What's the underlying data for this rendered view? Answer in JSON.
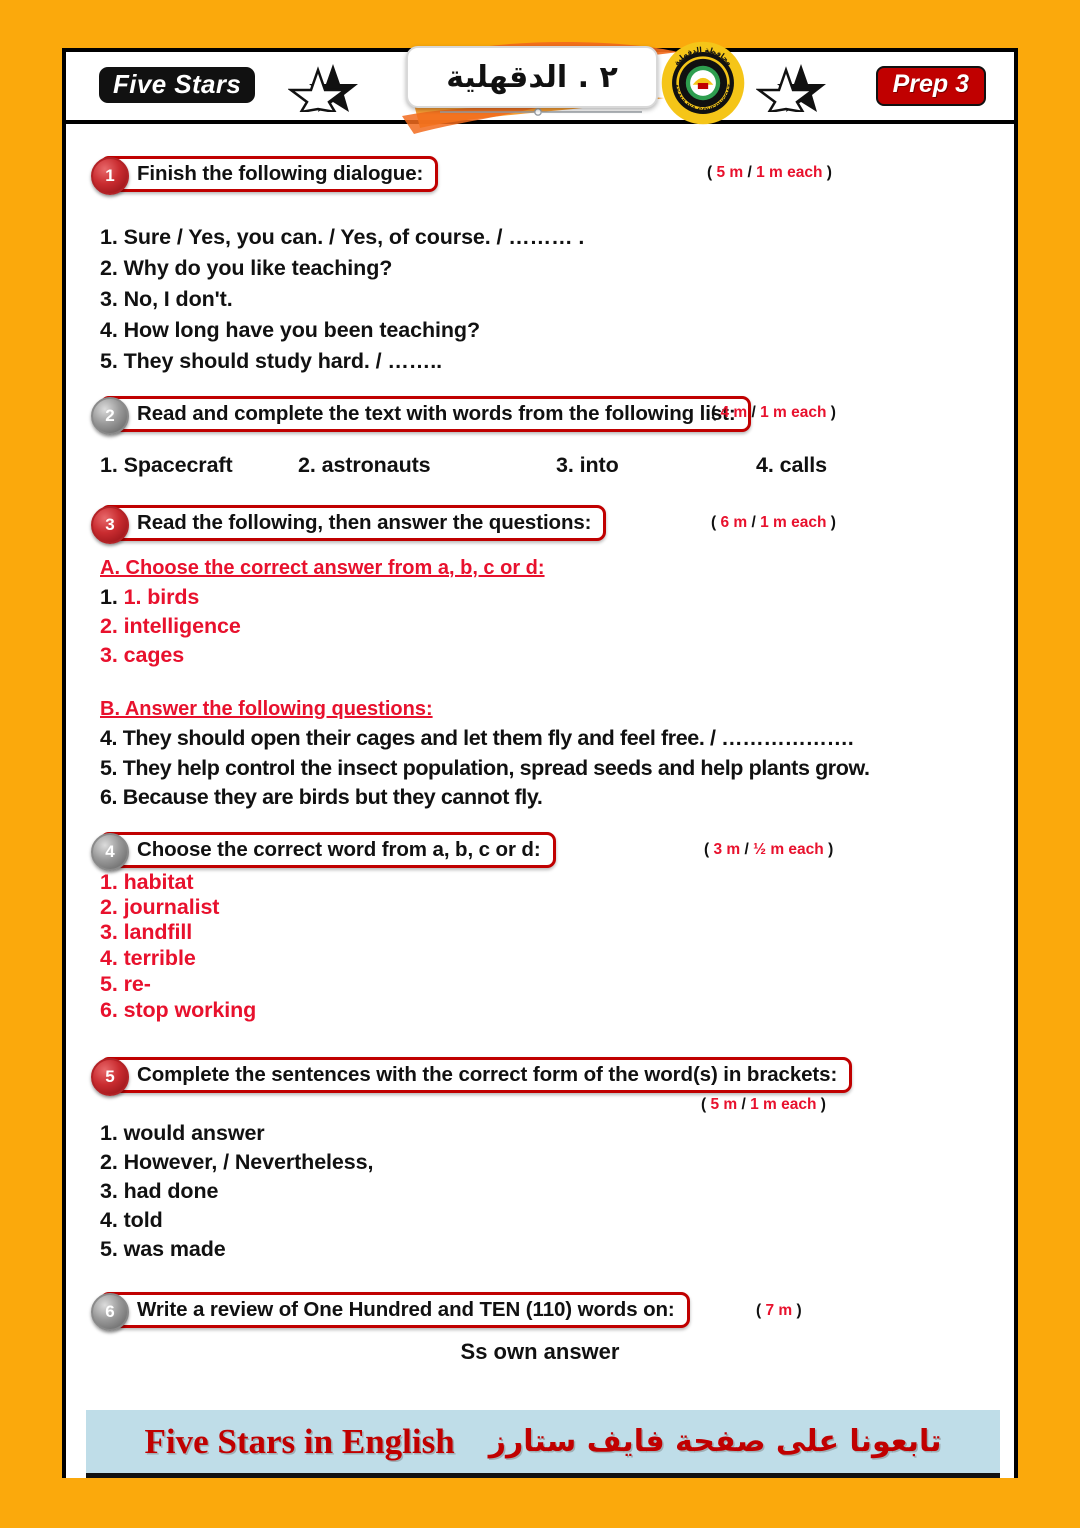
{
  "header": {
    "brand": "Five Stars",
    "title_ar": "٢ . الدقهلية",
    "grade": "Prep 3",
    "emblem_name": "dakahlia-governorate-seal",
    "emblem_text_ar": "محافظة الدقهلية",
    "emblem_text_en": "DAKAHLIYA GOVERNORATE"
  },
  "colors": {
    "page_background": "#FBA90C",
    "accent_red": "#C00000",
    "answer_red": "#E8112D",
    "footer_background": "#BFDDE8",
    "frame_black": "#000000"
  },
  "questions": [
    {
      "number": "1",
      "badge_color": "red",
      "prompt": "Finish the following dialogue:",
      "marks": {
        "total": "5 m",
        "each": "1 m each"
      },
      "answers": [
        "1. Sure / Yes, you can. / Yes, of course. / ……… .",
        "2. Why do you like teaching?",
        "3. No, I don't.",
        "4. How long have you been teaching?",
        "5. They should study hard. / …….."
      ]
    },
    {
      "number": "2",
      "badge_color": "grey",
      "prompt": "Read and complete the text with words from the following list:",
      "marks": {
        "total": "4 m",
        "each": "1 m each"
      },
      "word_list": [
        "1. Spacecraft",
        "2. astronauts",
        "3. into",
        "4. calls"
      ]
    },
    {
      "number": "3",
      "badge_color": "red",
      "prompt": "Read the following, then answer the questions:",
      "marks": {
        "total": "6 m",
        "each": "1 m each"
      },
      "section_a_title": "A. Choose the correct answer from a, b, c or d:",
      "section_a_answers": [
        "1. birds",
        "2. intelligence",
        "3. cages"
      ],
      "section_b_title": "B. Answer the following questions:",
      "section_b_answers": [
        "4. They should open their cages and let them fly and feel free. / ……………….",
        "5. They help control the insect population, spread seeds and help plants grow.",
        "6. Because they are birds but they cannot fly."
      ]
    },
    {
      "number": "4",
      "badge_color": "grey",
      "prompt": "Choose the correct word from a, b, c or d:",
      "marks": {
        "total": "3 m",
        "each": "½ m each"
      },
      "answers": [
        "1. habitat",
        "2. journalist",
        "3. landfill",
        "4. terrible",
        "5. re-",
        "6. stop working"
      ]
    },
    {
      "number": "5",
      "badge_color": "red",
      "prompt": "Complete the sentences with the correct form of the word(s) in brackets:",
      "marks": {
        "total": "5 m",
        "each": "1 m each"
      },
      "answers": [
        "1. would  answer",
        "2. However, / Nevertheless,",
        "3. had done",
        "4. told",
        "5. was made"
      ]
    },
    {
      "number": "6",
      "badge_color": "grey",
      "prompt": "Write a review of One Hundred and TEN (110) words on:",
      "marks": {
        "total": "7 m",
        "each": ""
      },
      "answer_note": "Ss own answer"
    }
  ],
  "footer": {
    "english": "Five Stars in English",
    "arabic": "تابعونا على صفحة فايف ستارز"
  }
}
